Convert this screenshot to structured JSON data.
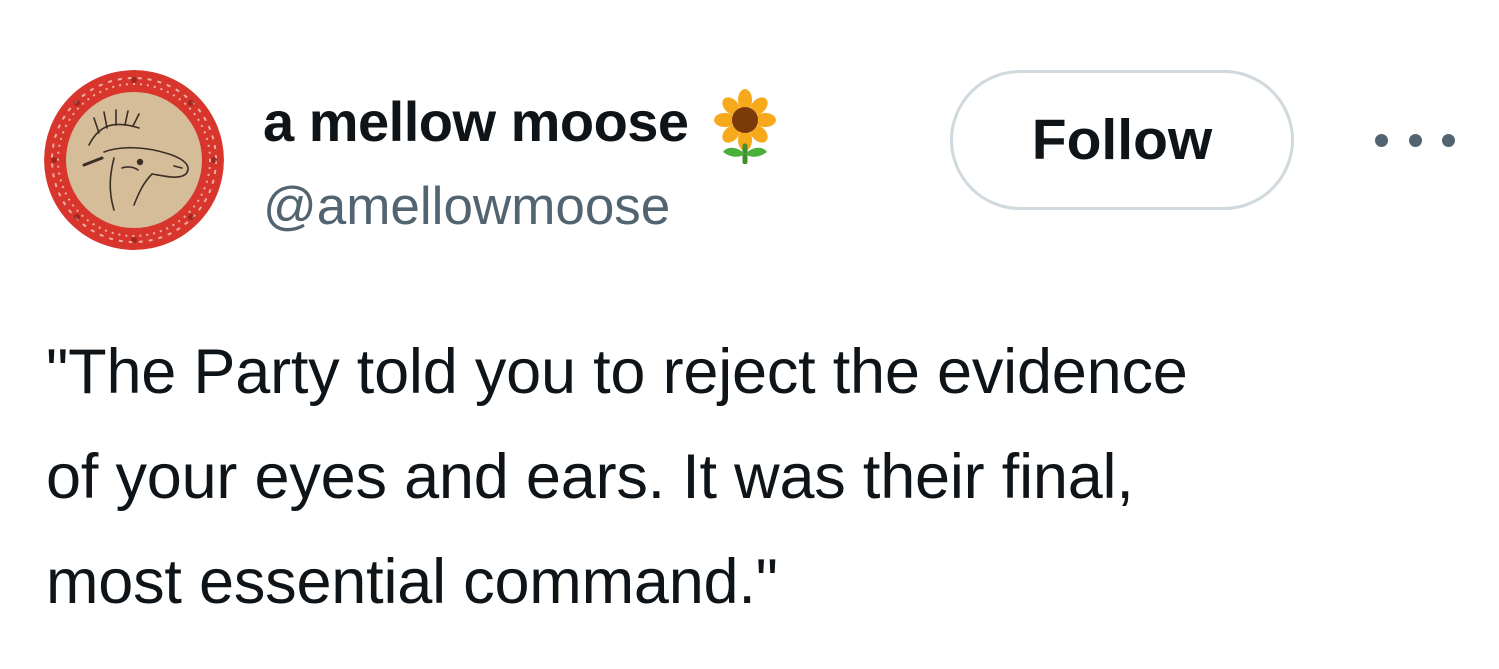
{
  "author": {
    "display_name": "a mellow moose",
    "name_emoji": "sunflower-icon",
    "handle": "@amellowmoose"
  },
  "actions": {
    "follow_label": "Follow",
    "more_icon": "more-icon"
  },
  "tweet": {
    "text_lines": [
      "\"The Party told you to reject the evidence",
      "of your eyes and ears. It was their final,",
      "most essential command.\""
    ]
  },
  "colors": {
    "text_primary": "#0f1419",
    "text_secondary": "#536471",
    "border": "#cfd9de",
    "avatar_ring": "#d8352d",
    "avatar_inner": "#d6bd9a"
  }
}
